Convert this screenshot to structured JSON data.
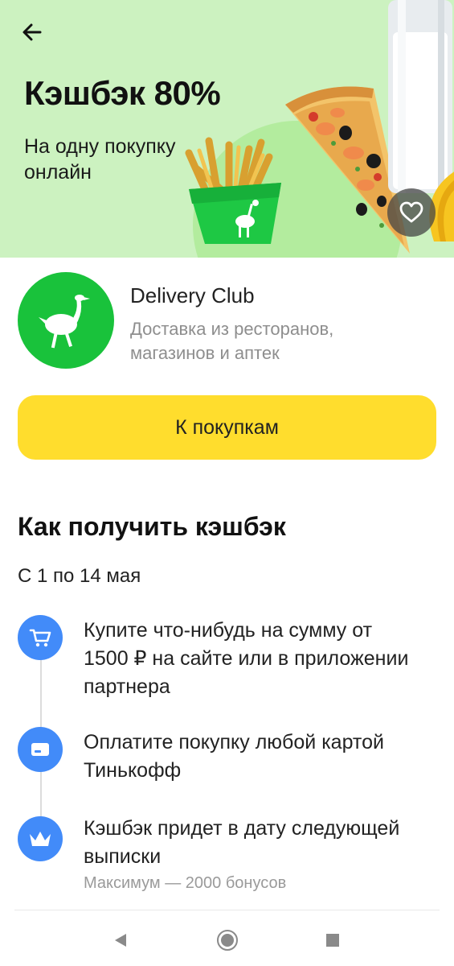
{
  "hero": {
    "title": "Кэшбэк 80%",
    "subtitle": "На одну покупку онлайн",
    "background_color": "#ccf2c0",
    "illustrations": [
      "fries-illustration",
      "pizza-illustration",
      "milk-illustration",
      "banana-illustration"
    ]
  },
  "partner": {
    "name": "Delivery Club",
    "description": "Доставка из ресторанов, магазинов и аптек",
    "logo_color": "#19c23b",
    "logo_icon": "ostrich-icon"
  },
  "cta": {
    "label": "К покупкам",
    "color": "#ffdd2d"
  },
  "how_to": {
    "title": "Как получить кэшбэк",
    "period": "С 1 по 14 мая",
    "steps": [
      {
        "icon": "cart-icon",
        "text": "Купите что-нибудь на сумму от 1500 ₽ на сайте или в приложении партнера"
      },
      {
        "icon": "card-icon",
        "text": "Оплатите покупку любой картой Тинькофф"
      },
      {
        "icon": "crown-icon",
        "text": "Кэшбэк придет в дату следующей выписки",
        "note": "Максимум — 2000 бонусов"
      }
    ],
    "icon_color": "#428bf9"
  },
  "nav": {
    "back_icon": "arrow-left-icon",
    "favorite_icon": "heart-icon",
    "system": [
      "triangle-back-icon",
      "circle-home-icon",
      "square-recents-icon"
    ]
  }
}
